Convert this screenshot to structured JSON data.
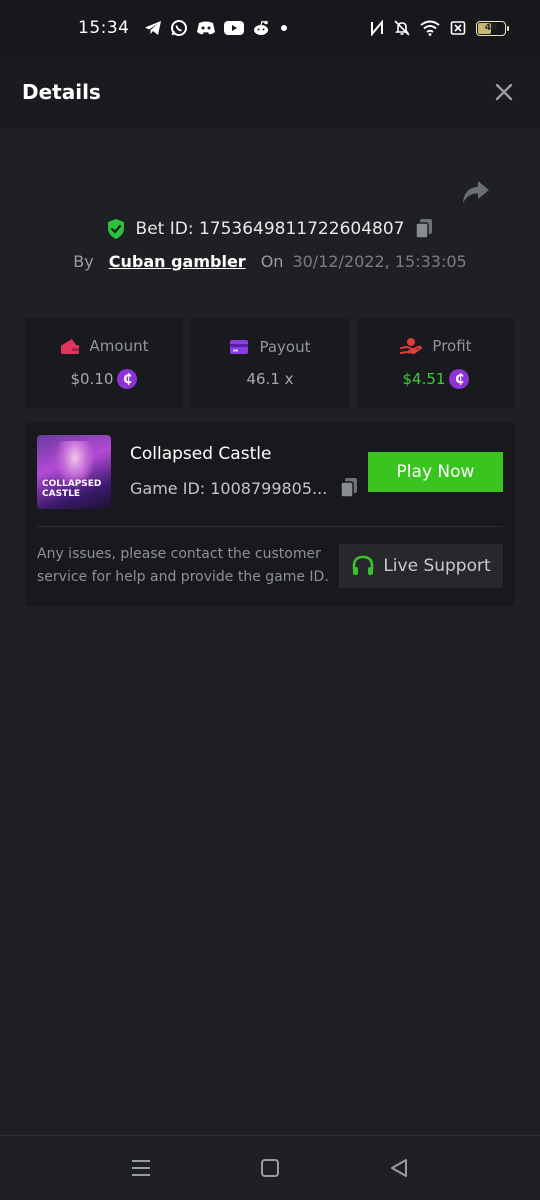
{
  "status_bar": {
    "time": "15:34",
    "app_icons": [
      "telegram-icon",
      "whatsapp-icon",
      "discord-icon",
      "youtube-icon",
      "reddit-icon",
      "dot-icon"
    ],
    "system_icons": [
      "nfc-icon",
      "bell-off-icon",
      "wifi-icon",
      "sim-off-icon"
    ],
    "battery": "46"
  },
  "header": {
    "title": "Details"
  },
  "bet": {
    "id_text": "Bet ID: 1753649811722604807",
    "by_label": "By",
    "username": "Cuban gambler",
    "on_label": "On",
    "datetime": "30/12/2022, 15:33:05"
  },
  "stats": {
    "amount_label": "Amount",
    "amount_value": "$0.10",
    "payout_label": "Payout",
    "payout_value": "46.1 x",
    "profit_label": "Profit",
    "profit_value": "$4.51",
    "coin_symbol": "₵"
  },
  "game": {
    "thumb_text": "COLLAPSED CASTLE",
    "name": "Collapsed Castle",
    "id_text": "Game ID: 1008799805...",
    "play_label": "Play Now",
    "help_text": "Any issues, please contact the customer service for help and provide the game ID.",
    "support_label": "Live Support"
  },
  "colors": {
    "accent_green": "#3ac41f",
    "profit_green": "#3ccb35",
    "coin_purple": "#8d31d8",
    "shield_green": "#2ec13b"
  }
}
